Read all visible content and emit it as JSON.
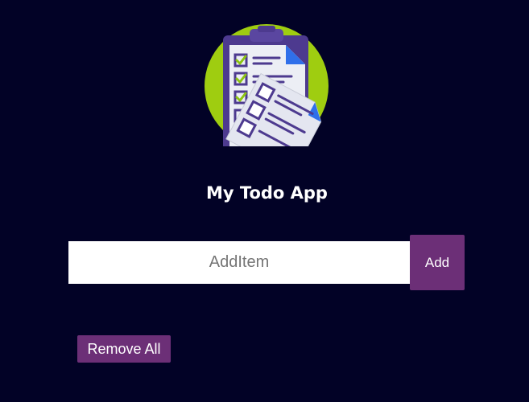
{
  "app": {
    "title": "My Todo App",
    "logo_icon": "todo-checklist-icon"
  },
  "form": {
    "input_value": "",
    "input_placeholder": "AddItem",
    "add_label": "Add"
  },
  "actions": {
    "remove_all_label": "Remove All"
  },
  "colors": {
    "background": "#020226",
    "button": "#6c2f77",
    "logo_circle": "#9fcd10",
    "clipboard": "#4d3a8f",
    "check": "#8cc312",
    "accent_blue": "#2f6fea"
  }
}
